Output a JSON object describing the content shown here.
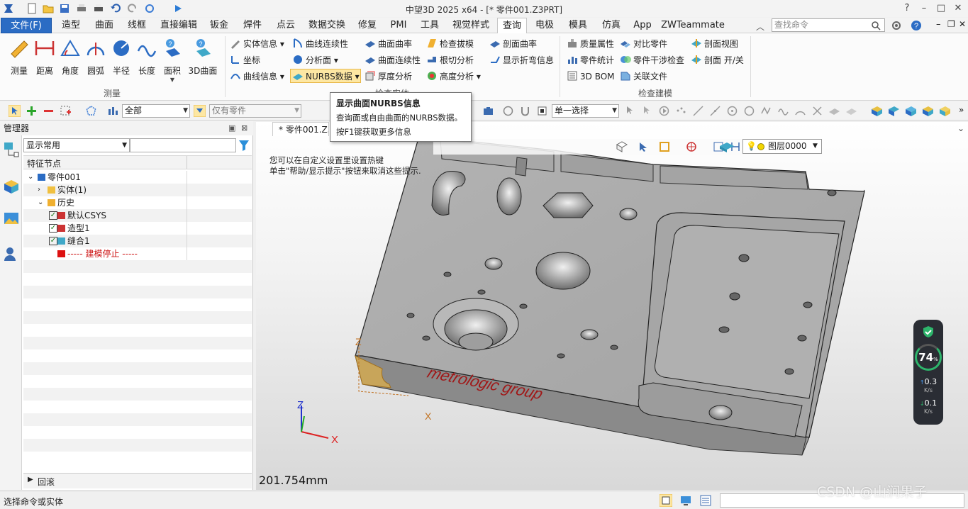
{
  "window": {
    "title": "中望3D 2025 x64 - [* 零件001.Z3PRT]",
    "controls": [
      "–",
      "□",
      "✕"
    ]
  },
  "menu": {
    "file": "文件(F)",
    "tabs": [
      "造型",
      "曲面",
      "线框",
      "直接编辑",
      "钣金",
      "焊件",
      "点云",
      "数据交换",
      "修复",
      "PMI",
      "工具",
      "视觉样式",
      "查询",
      "电极",
      "模具",
      "仿真",
      "App",
      "ZWTeammate"
    ],
    "active_tab": "查询",
    "search_placeholder": "查找命令"
  },
  "ribbon": {
    "measure_group": {
      "label": "测量",
      "buttons": [
        "测量",
        "距离",
        "角度",
        "圆弧",
        "半径",
        "长度",
        "面积",
        "3D曲面"
      ]
    },
    "check_group": {
      "label": "检查实体",
      "col1": [
        "实体信息",
        "坐标",
        "曲线信息"
      ],
      "col2": [
        "曲线连续性",
        "分析面",
        "NURBS数据"
      ],
      "col3": [
        "曲面曲率",
        "曲面连续性",
        "厚度分析"
      ],
      "col4": [
        "检查拔模",
        "根切分析",
        "高度分析"
      ],
      "col5": [
        "剖面曲率",
        "显示折弯信息"
      ]
    },
    "model_group": {
      "label": "检查建模",
      "col1": [
        "质量属性",
        "零件统计",
        "3D BOM"
      ],
      "col2": [
        "对比零件",
        "零件干涉检查",
        "关联文件"
      ],
      "col3": [
        "剖面视图",
        "剖面 开/关"
      ]
    }
  },
  "tooltip": {
    "title": "显示曲面NURBS信息",
    "line1": "查询面或自由曲面的NURBS数据。",
    "line2": "按F1键获取更多信息"
  },
  "toolbar": {
    "filter_value": "全部",
    "part_filter": "仅有零件",
    "select_mode": "单一选择"
  },
  "manager": {
    "title": "管理器",
    "display_combo": "显示常用",
    "column_header": "特征节点",
    "tree": [
      {
        "label": "零件001",
        "indent": 0
      },
      {
        "label": "实体(1)",
        "indent": 1
      },
      {
        "label": "历史",
        "indent": 1
      },
      {
        "label": "默认CSYS",
        "indent": 2
      },
      {
        "label": "造型1",
        "indent": 2
      },
      {
        "label": "缝合1",
        "indent": 2
      },
      {
        "label": "----- 建模停止 -----",
        "indent": 2
      }
    ],
    "rollback": "回滚"
  },
  "viewport": {
    "doc_tab": "* 零件001.Z3P",
    "hint_line1": "您可以在自定义设置里设置热键",
    "hint_line2": "单击\"帮助/显示提示\"按钮来取消这些提示.",
    "layer": "图层0000",
    "dimension": "201.754mm",
    "engraving": "metrologic group",
    "axis_x": "X",
    "axis_y": "Y",
    "axis_z": "Z"
  },
  "network_widget": {
    "percent": "74",
    "percent_unit": "%",
    "up_value": "0.3",
    "up_unit": "K/s",
    "down_value": "0.1",
    "down_unit": "K/s"
  },
  "status": {
    "message": "选择命令或实体"
  },
  "watermark": "CSDN @山涧果子",
  "colors": {
    "file_tab": "#2b6cc4",
    "part_gray": "#a8a8a8",
    "engrave_red": "#a01818",
    "tree_stop_red": "#cc1111"
  }
}
